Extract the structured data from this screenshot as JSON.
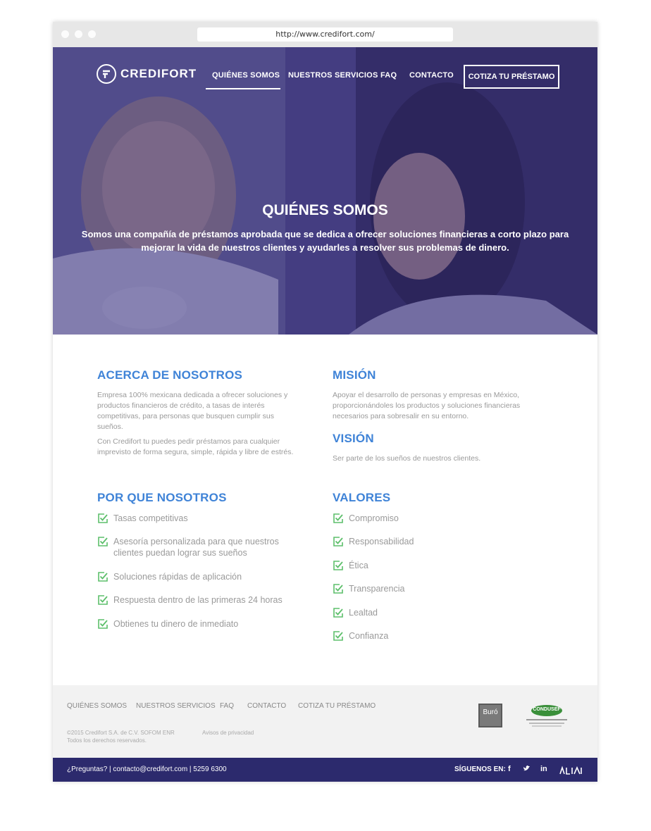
{
  "browser": {
    "url": "http://www.credifort.com/"
  },
  "brand": {
    "name": "CREDIFORT"
  },
  "nav": {
    "items": [
      "QUIÉNES SOMOS",
      "NUESTROS SERVICIOS",
      "FAQ",
      "CONTACTO"
    ],
    "cta": "COTIZA TU PRÉSTAMO"
  },
  "hero": {
    "title": "QUIÉNES SOMOS",
    "subtitle_line1": "Somos una compañía de préstamos aprobada que se dedica a ofrecer soluciones financieras a corto plazo para",
    "subtitle_line2": "mejorar la vida de nuestros clientes y ayudarles a resolver sus problemas de dinero."
  },
  "about": {
    "title": "ACERCA DE NOSOTROS",
    "p1": [
      "Empresa 100% mexicana dedicada a ofrecer soluciones y",
      "productos financieros de crédito, a tasas de interés",
      "competitivas, para personas que busquen cumplir sus",
      "sueños."
    ],
    "p2": [
      "Con Credifort tu puedes pedir préstamos para cualquier",
      "imprevisto de forma segura, simple, rápida y libre de estrés."
    ]
  },
  "mission": {
    "title": "MISIÓN",
    "p": [
      "Apoyar el desarrollo de personas y empresas en México,",
      "proporcionándoles los productos y soluciones financieras",
      "necesarios para sobresalir en su entorno."
    ]
  },
  "vision": {
    "title": "VISIÓN",
    "p": "Ser parte de los sueños de nuestros clientes."
  },
  "why": {
    "title": "POR QUE NOSOTROS",
    "items": [
      [
        "Tasas competitivas"
      ],
      [
        "Asesoría personalizada para que nuestros",
        "clientes puedan lograr sus sueños"
      ],
      [
        "Soluciones rápidas de aplicación"
      ],
      [
        "Respuesta dentro de las primeras 24 horas"
      ],
      [
        "Obtienes tu dinero de inmediato"
      ]
    ]
  },
  "values": {
    "title": "VALORES",
    "items": [
      "Compromiso",
      "Responsabilidad",
      "Ética",
      "Transparencia",
      "Lealtad",
      "Confianza"
    ]
  },
  "footer": {
    "links": [
      "QUIÉNES SOMOS",
      "NUESTROS SERVICIOS",
      "FAQ",
      "CONTACTO",
      "COTIZA TU PRÉSTAMO"
    ],
    "copyright1": "©2015 Credifort S.A. de C.V. SOFOM ENR",
    "copyright2": "Todos los derechos reservados.",
    "privacy": "Avisos de privacidad",
    "buro": "Buró",
    "condusef": "CONDUSEF"
  },
  "bottom": {
    "contact": "¿Preguntas? | contacto@credifort.com | 5259 6300",
    "follow": "SÍGUENOS EN:",
    "social": [
      "f",
      "t",
      "in"
    ]
  },
  "colors": {
    "accent": "#3f83d7",
    "check": "#5dbf6b",
    "dark_bar": "#2c2a6d",
    "hero_tint": "#2d2678"
  }
}
